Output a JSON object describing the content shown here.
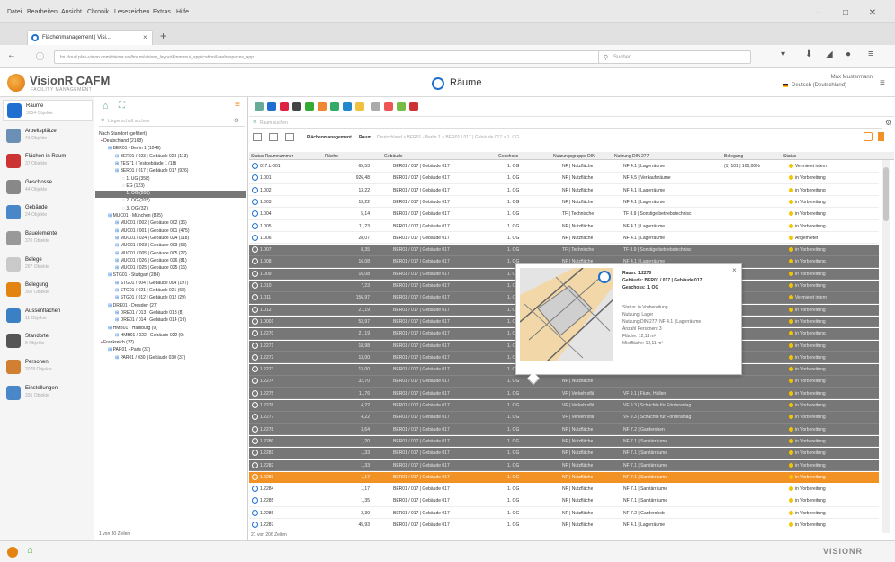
{
  "menubar": {
    "items": [
      "Datei",
      "Bearbeiten",
      "Ansicht",
      "Chronik",
      "Lesezeichen",
      "Extras",
      "Hilfe"
    ]
  },
  "browser": {
    "tab_title": "Flächenmanagement | Visi...",
    "url": "hs.cloud.plan-vision.com/visionr.vaj/hnum/visionr_layout&mmhnui_application&areh=spaces_app",
    "search_placeholder": "Suchen"
  },
  "app": {
    "logo_title": "VisionR CAFM",
    "logo_subtitle": "FACILITY MANAGEMENT",
    "page_title": "Räume",
    "user_name": "Max Mustermann",
    "language": "Deutsch (Deutschland)"
  },
  "nav": {
    "items": [
      {
        "title": "Räume",
        "sub": "3054 Objekte"
      },
      {
        "title": "Arbeitsplätze",
        "sub": "41 Objekte"
      },
      {
        "title": "Flächen in Raum",
        "sub": "37 Objekte"
      },
      {
        "title": "Geschosse",
        "sub": "44 Objekte"
      },
      {
        "title": "Gebäude",
        "sub": "24 Objekte"
      },
      {
        "title": "Bauelemente",
        "sub": "370 Objekte"
      },
      {
        "title": "Belege",
        "sub": "267 Objekte"
      },
      {
        "title": "Belegung",
        "sub": "305 Objekte"
      },
      {
        "title": "Aussenflächen",
        "sub": "11 Objekte"
      },
      {
        "title": "Standorte",
        "sub": "8 Objekte"
      },
      {
        "title": "Personen",
        "sub": "2078 Objekte"
      },
      {
        "title": "Einstellungen",
        "sub": "335 Objekte"
      }
    ]
  },
  "tree": {
    "search_placeholder": "Liegenschaft suchen",
    "header": "Nach Standort (gefiltert)",
    "rows": [
      {
        "indent": 0,
        "text": "Deutschland (2168)"
      },
      {
        "indent": 1,
        "text": "BER01 - Berlin 1 (1049)"
      },
      {
        "indent": 2,
        "text": "BER01 / 023 | Gebäude 023 (113)"
      },
      {
        "indent": 2,
        "text": "TEST1 | Testgebäude 1 (18)"
      },
      {
        "indent": 2,
        "text": "BER01 / 017 | Gebäude 017 (926)"
      },
      {
        "indent": 3,
        "text": "1. UG (358)"
      },
      {
        "indent": 3,
        "text": "EG (123)"
      },
      {
        "indent": 3,
        "text": "1. OG (208)",
        "selected": true
      },
      {
        "indent": 3,
        "text": "2. OG (205)"
      },
      {
        "indent": 3,
        "text": "3. OG (32)"
      },
      {
        "indent": 1,
        "text": "MUC01 - München (835)"
      },
      {
        "indent": 2,
        "text": "MUC01 / 002 | Gebäude 002 (36)"
      },
      {
        "indent": 2,
        "text": "MUC01 / 001 | Gebäude 001 (475)"
      },
      {
        "indent": 2,
        "text": "MUC01 / 024 | Gebäude 024 (118)"
      },
      {
        "indent": 2,
        "text": "MUC01 / 003 | Gebäude 003 (63)"
      },
      {
        "indent": 2,
        "text": "MUC01 / 005 | Gebäude 005 (27)"
      },
      {
        "indent": 2,
        "text": "MUC01 / 026 | Gebäude 026 (81)"
      },
      {
        "indent": 2,
        "text": "MUC01 / 025 | Gebäude 025 (16)"
      },
      {
        "indent": 1,
        "text": "STG01 - Stuttgart (284)"
      },
      {
        "indent": 2,
        "text": "STG01 / 004 | Gebäude 004 (197)"
      },
      {
        "indent": 2,
        "text": "STG01 / 021 | Gebäude 021 (68)"
      },
      {
        "indent": 2,
        "text": "STG01 / 012 | Gebäude 012 (29)"
      },
      {
        "indent": 1,
        "text": "DRE01 - Dresden (27)"
      },
      {
        "indent": 2,
        "text": "DRE01 / 013 | Gebäude 013 (8)"
      },
      {
        "indent": 2,
        "text": "DRE01 / 014 | Gebäude 014 (19)"
      },
      {
        "indent": 1,
        "text": "HMB01 - Hamburg (9)"
      },
      {
        "indent": 2,
        "text": "HMB01 / 022 | Gebäude 022 (9)"
      },
      {
        "indent": 0,
        "text": "Frankreich (37)"
      },
      {
        "indent": 1,
        "text": "PAR01 - Paris (37)"
      },
      {
        "indent": 2,
        "text": "PAR01 / 030 | Gebäude 030 (37)"
      }
    ],
    "footer": "1 von 30 Zeilen"
  },
  "grid": {
    "search_placeholder": "Raum suchen",
    "breadcrumb_title": "Flächenmanagement",
    "breadcrumb_sub": "Raum",
    "breadcrumb_path": "Deutschland > BER01 - Berlin 1 > BER01 / 017 | Gebäude 017 > 1. OG",
    "columns": [
      "Status Raumnummer",
      "Fläche",
      "Gebäude",
      "Geschoss",
      "Nutzungsgruppe DIN",
      "Nutzung DIN 277",
      "Belegung",
      "Status"
    ],
    "rows": [
      {
        "s": "n",
        "nr": "017.L-001",
        "fl": "65,53",
        "geb": "BER01 / 017 | Gebäude 017",
        "gs": "1. OG",
        "ng": "NF | Nutzfläche",
        "nu": "NF 4.1 | Lagerräume",
        "bel": "(1) 101 | 100,00%",
        "st": "Vermietet intern"
      },
      {
        "s": "n",
        "nr": "1.001",
        "fl": "926,48",
        "geb": "BER01 / 017 | Gebäude 017",
        "gs": "1. OG",
        "ng": "NF | Nutzfläche",
        "nu": "NF 4.5 | Verkaufsräume",
        "bel": "",
        "st": "in Vorbereitung"
      },
      {
        "s": "n",
        "nr": "1.002",
        "fl": "13,22",
        "geb": "BER01 / 017 | Gebäude 017",
        "gs": "1. OG",
        "ng": "NF | Nutzfläche",
        "nu": "NF 4.1 | Lagerräume",
        "bel": "",
        "st": "in Vorbereitung"
      },
      {
        "s": "n",
        "nr": "1.003",
        "fl": "13,22",
        "geb": "BER01 / 017 | Gebäude 017",
        "gs": "1. OG",
        "ng": "NF | Nutzfläche",
        "nu": "NF 4.1 | Lagerräume",
        "bel": "",
        "st": "in Vorbereitung"
      },
      {
        "s": "n",
        "nr": "1.004",
        "fl": "5,14",
        "geb": "BER01 / 017 | Gebäude 017",
        "gs": "1. OG",
        "ng": "TF | Technische",
        "nu": "TF 8.9 | Sonstige betriebstechnisc",
        "bel": "",
        "st": "in Vorbereitung"
      },
      {
        "s": "n",
        "nr": "1.005",
        "fl": "11,23",
        "geb": "BER01 / 017 | Gebäude 017",
        "gs": "1. OG",
        "ng": "NF | Nutzfläche",
        "nu": "NF 4.1 | Lagerräume",
        "bel": "",
        "st": "in Vorbereitung"
      },
      {
        "s": "n",
        "nr": "1.006",
        "fl": "28,07",
        "geb": "BER01 / 017 | Gebäude 017",
        "gs": "1. OG",
        "ng": "NF | Nutzfläche",
        "nu": "NF 4.1 | Lagerräume",
        "bel": "",
        "st": "Angemietet"
      },
      {
        "s": "s",
        "nr": "1.007",
        "fl": "8,35",
        "geb": "BER01 / 017 | Gebäude 017",
        "gs": "1. OG",
        "ng": "TF | Technische",
        "nu": "TF 8.9 | Sonstige betriebstechnisc",
        "bel": "",
        "st": "in Vorbereitung"
      },
      {
        "s": "s",
        "nr": "1.008",
        "fl": "16,08",
        "geb": "BER01 / 017 | Gebäude 017",
        "gs": "1. OG",
        "ng": "NF | Nutzfläche",
        "nu": "NF 4.1 | Lagerräume",
        "bel": "",
        "st": "in Vorbereitung"
      },
      {
        "s": "s",
        "nr": "1.009",
        "fl": "16,08",
        "geb": "BER01 / 017 | Gebäude 017",
        "gs": "1. OG",
        "ng": "NF | Nutzfläche",
        "nu": "",
        "bel": "",
        "st": "in Vorbereitung"
      },
      {
        "s": "s",
        "nr": "1.010",
        "fl": "7,23",
        "geb": "BER01 / 017 | Gebäude 017",
        "gs": "1. OG",
        "ng": "NF | Nutzfläche",
        "nu": "",
        "bel": "",
        "st": "in Vorbereitung"
      },
      {
        "s": "s",
        "nr": "1.011",
        "fl": "156,97",
        "geb": "BER01 / 017 | Gebäude 017",
        "gs": "1. OG",
        "ng": "NF | Nutzfläche",
        "nu": "",
        "bel": "",
        "st": "Vermietet intern"
      },
      {
        "s": "s",
        "nr": "1.012",
        "fl": "21,19",
        "geb": "BER01 / 017 | Gebäude 017",
        "gs": "1. OG",
        "ng": "NF | Nutzfläche",
        "nu": "",
        "bel": "",
        "st": "in Vorbereitung"
      },
      {
        "s": "s",
        "nr": "1.0001",
        "fl": "53,97",
        "geb": "BER01 / 017 | Gebäude 017",
        "gs": "1. OG",
        "ng": "NF | Nutzfläche",
        "nu": "",
        "bel": "",
        "st": "in Vorbereitung"
      },
      {
        "s": "s",
        "nr": "1.2270",
        "fl": "21,19",
        "geb": "BER01 / 017 | Gebäude 017",
        "gs": "1. OG",
        "ng": "NF | Nutzfläche",
        "nu": "",
        "bel": "",
        "st": "in Vorbereitung"
      },
      {
        "s": "s",
        "nr": "1.2271",
        "fl": "18,98",
        "geb": "BER01 / 017 | Gebäude 017",
        "gs": "1. OG",
        "ng": "NF | Nutzfläche",
        "nu": "",
        "bel": "",
        "st": "in Vorbereitung"
      },
      {
        "s": "s",
        "nr": "1.2272",
        "fl": "13,00",
        "geb": "BER01 / 017 | Gebäude 017",
        "gs": "1. OG",
        "ng": "NF | Nutzfläche",
        "nu": "",
        "bel": "",
        "st": "in Vorbereitung"
      },
      {
        "s": "s",
        "nr": "1.2273",
        "fl": "13,00",
        "geb": "BER01 / 017 | Gebäude 017",
        "gs": "1. OG",
        "ng": "NF | Nutzfläche",
        "nu": "",
        "bel": "",
        "st": "in Vorbereitung"
      },
      {
        "s": "s",
        "nr": "1.2274",
        "fl": "32,70",
        "geb": "BER01 / 017 | Gebäude 017",
        "gs": "1. OG",
        "ng": "NF | Nutzfläche",
        "nu": "",
        "bel": "",
        "st": "in Vorbereitung"
      },
      {
        "s": "s",
        "nr": "1.2275",
        "fl": "11,76",
        "geb": "BER01 / 017 | Gebäude 017",
        "gs": "1. OG",
        "ng": "VF | Verkehrsflä",
        "nu": "VF 9.1 | Flure, Hallen",
        "bel": "",
        "st": "in Vorbereitung"
      },
      {
        "s": "s",
        "nr": "1.2276",
        "fl": "4,22",
        "geb": "BER01 / 017 | Gebäude 017",
        "gs": "1. OG",
        "ng": "VF | Verkehrsflä",
        "nu": "VF 9.3 | Schächte für Förderanlag",
        "bel": "",
        "st": "in Vorbereitung"
      },
      {
        "s": "s",
        "nr": "1.2277",
        "fl": "4,22",
        "geb": "BER01 / 017 | Gebäude 017",
        "gs": "1. OG",
        "ng": "VF | Verkehrsflä",
        "nu": "VF 9.3 | Schächte für Förderanlag",
        "bel": "",
        "st": "in Vorbereitung"
      },
      {
        "s": "s",
        "nr": "1.2278",
        "fl": "3,64",
        "geb": "BER01 / 017 | Gebäude 017",
        "gs": "1. OG",
        "ng": "NF | Nutzfläche",
        "nu": "NF 7.2 | Garderoben",
        "bel": "",
        "st": "in Vorbereitung"
      },
      {
        "s": "s",
        "nr": "1.2280",
        "fl": "1,20",
        "geb": "BER01 / 017 | Gebäude 017",
        "gs": "1. OG",
        "ng": "NF | Nutzfläche",
        "nu": "NF 7.1 | Sanitärräume",
        "bel": "",
        "st": "in Vorbereitung"
      },
      {
        "s": "s",
        "nr": "1.2281",
        "fl": "1,33",
        "geb": "BER01 / 017 | Gebäude 017",
        "gs": "1. OG",
        "ng": "NF | Nutzfläche",
        "nu": "NF 7.1 | Sanitärräume",
        "bel": "",
        "st": "in Vorbereitung"
      },
      {
        "s": "s",
        "nr": "1.2282",
        "fl": "1,33",
        "geb": "BER01 / 017 | Gebäude 017",
        "gs": "1. OG",
        "ng": "NF | Nutzfläche",
        "nu": "NF 7.1 | Sanitärräume",
        "bel": "",
        "st": "in Vorbereitung"
      },
      {
        "s": "h",
        "nr": "1.2283",
        "fl": "1,17",
        "geb": "BER01 / 017 | Gebäude 017",
        "gs": "1. OG",
        "ng": "NF | Nutzfläche",
        "nu": "NF 7.1 | Sanitärräume",
        "bel": "",
        "st": "in Vorbereitung"
      },
      {
        "s": "n",
        "nr": "1.2284",
        "fl": "1,17",
        "geb": "BER01 / 017 | Gebäude 017",
        "gs": "1. OG",
        "ng": "NF | Nutzfläche",
        "nu": "NF 7.1 | Sanitärräume",
        "bel": "",
        "st": "in Vorbereitung"
      },
      {
        "s": "n",
        "nr": "1.2285",
        "fl": "1,35",
        "geb": "BER01 / 017 | Gebäude 017",
        "gs": "1. OG",
        "ng": "NF | Nutzfläche",
        "nu": "NF 7.1 | Sanitärräume",
        "bel": "",
        "st": "in Vorbereitung"
      },
      {
        "s": "n",
        "nr": "1.2286",
        "fl": "2,39",
        "geb": "BER01 / 017 | Gebäude 017",
        "gs": "1. OG",
        "ng": "NF | Nutzfläche",
        "nu": "NF 7.2 | Garderobeb",
        "bel": "",
        "st": "in Vorbereitung"
      },
      {
        "s": "n",
        "nr": "1.2287",
        "fl": "45,93",
        "geb": "BER01 / 017 | Gebäude 017",
        "gs": "1. OG",
        "ng": "NF | Nutzfläche",
        "nu": "NF 4.1 | Lagerräume",
        "bel": "",
        "st": "in Vorbereitung"
      }
    ],
    "footer": "21 von 206 Zeilen"
  },
  "popup": {
    "raum": "Raum: 1.2270",
    "gebaeude": "Gebäude: BER01 / 017 | Gebäude 017",
    "geschoss": "Geschoss: 1. OG",
    "status": "Status: in Vorbereitung",
    "nutzung": "Nutzung: Lager",
    "nutzung_din": "Nutzung DIN 277: NF 4.1 | Lagerräume",
    "personen": "Anzahl Personen: 3",
    "flaeche": "Fläche: 12,11 m²",
    "mietflaeche": "Mietfläche: 12,11 m²",
    "close": "×"
  },
  "footer": {
    "brand": "VISIONR"
  },
  "colors": {
    "accent": "#f39224",
    "selected_row": "#777777",
    "status_dot": "#f5c400"
  }
}
